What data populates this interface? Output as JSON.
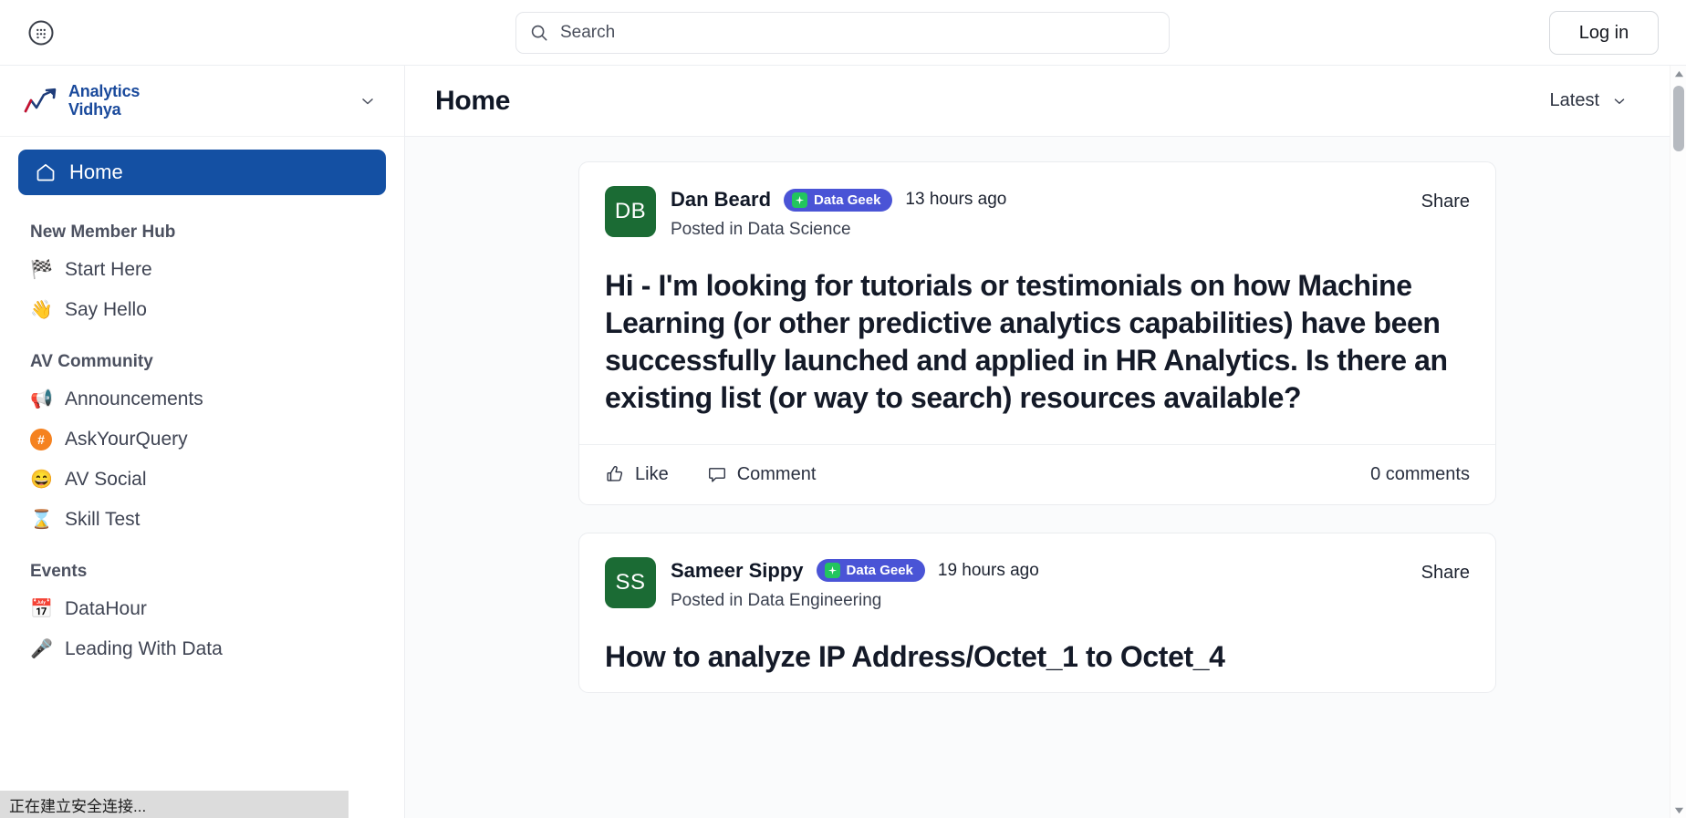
{
  "topbar": {
    "apps_icon": "apps-grid-circle-icon",
    "search": {
      "placeholder": "Search",
      "value": "",
      "icon": "search-icon"
    },
    "login_label": "Log in"
  },
  "sidebar": {
    "brand": {
      "line1": "Analytics",
      "line2": "Vidhya",
      "caret_icon": "chevron-down-icon",
      "color": "#1a4a9c",
      "accent_color": "#c8102e"
    },
    "active_item": {
      "label": "Home",
      "icon": "home-icon",
      "bg": "#1450a3"
    },
    "groups": [
      {
        "title": "New Member Hub",
        "items": [
          {
            "label": "Start Here",
            "emoji": "🏁",
            "icon": "checkered-flag-icon"
          },
          {
            "label": "Say Hello",
            "emoji": "👋",
            "icon": "waving-hand-icon"
          }
        ]
      },
      {
        "title": "AV Community",
        "items": [
          {
            "label": "Announcements",
            "emoji": "📢",
            "icon": "loudspeaker-icon"
          },
          {
            "label": "AskYourQuery",
            "emoji": "#",
            "icon": "hash-badge-icon",
            "badge_color": "#f58220"
          },
          {
            "label": "AV Social",
            "emoji": "😄",
            "icon": "smiling-face-icon"
          },
          {
            "label": "Skill Test",
            "emoji": "⌛",
            "icon": "hourglass-icon"
          }
        ]
      },
      {
        "title": "Events",
        "items": [
          {
            "label": "DataHour",
            "emoji": "📅",
            "icon": "calendar-icon"
          },
          {
            "label": "Leading With Data",
            "emoji": "🎤",
            "icon": "microphone-icon"
          }
        ]
      }
    ]
  },
  "main": {
    "page_title": "Home",
    "sort": {
      "label": "Latest",
      "icon": "chevron-down-icon"
    },
    "posts": [
      {
        "avatar_initials": "DB",
        "avatar_color": "#1b6b34",
        "author": "Dan Beard",
        "badge": {
          "label": "Data Geek",
          "color": "#4a54d6",
          "spark_color": "#22c55e"
        },
        "time": "13 hours ago",
        "posted_in": "Posted in Data Science",
        "share_label": "Share",
        "title": "Hi - I'm looking for tutorials or testimonials on how Machine Learning (or other predictive analytics capabilities) have been successfully launched and applied in HR Analytics. Is there an existing list (or way to search) resources available?",
        "like_label": "Like",
        "comment_label": "Comment",
        "comment_count": "0 comments"
      },
      {
        "avatar_initials": "SS",
        "avatar_color": "#1b6b34",
        "author": "Sameer Sippy",
        "badge": {
          "label": "Data Geek",
          "color": "#4a54d6",
          "spark_color": "#22c55e"
        },
        "time": "19 hours ago",
        "posted_in": "Posted in Data Engineering",
        "share_label": "Share",
        "title": "How to analyze IP Address/Octet_1 to Octet_4"
      }
    ]
  },
  "scrollbar": {
    "up_icon": "scroll-up-arrow-icon",
    "down_icon": "scroll-down-arrow-icon"
  },
  "browser_status": "正在建立安全连接..."
}
